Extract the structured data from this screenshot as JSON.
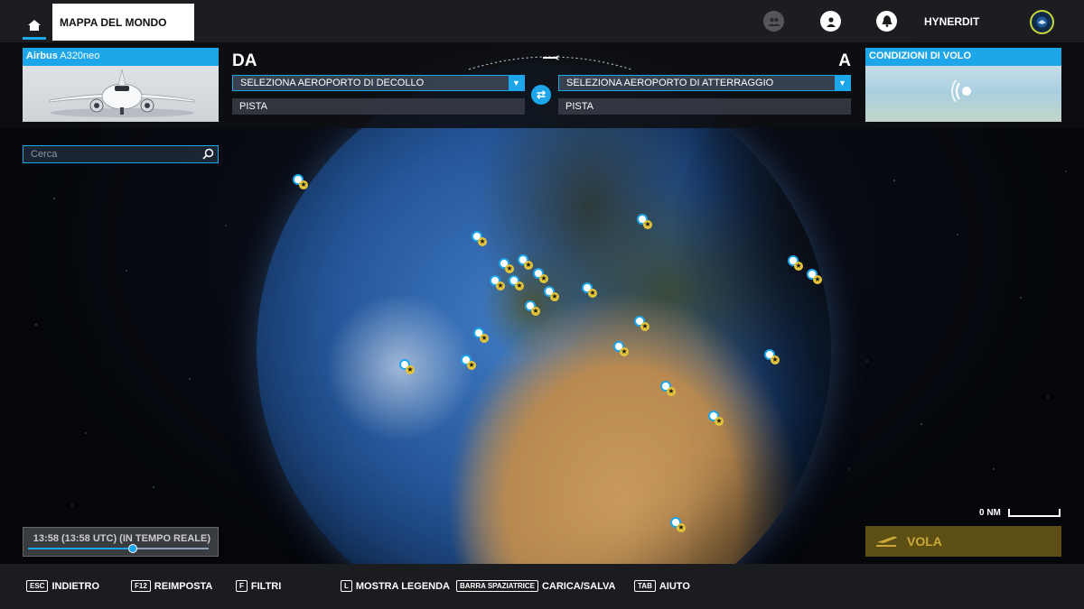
{
  "topbar": {
    "home_icon": "home-icon",
    "map_tab_label": "MAPPA DEL MONDO",
    "username": "HYNERDIT"
  },
  "aircraft": {
    "brand": "Airbus",
    "model": "A320neo"
  },
  "departure": {
    "label": "DA",
    "airport_placeholder": "SELEZIONA AEROPORTO DI DECOLLO",
    "runway_label": "PISTA"
  },
  "arrival": {
    "label": "A",
    "airport_placeholder": "SELEZIONA AEROPORTO DI ATTERRAGGIO",
    "runway_label": "PISTA"
  },
  "conditions": {
    "title": "CONDIZIONI DI VOLO"
  },
  "search": {
    "placeholder": "Cerca"
  },
  "time": {
    "label": "13:58 (13:58 UTC) (IN TEMPO REALE)",
    "progress": 0.58
  },
  "scale": {
    "label": "0 NM"
  },
  "fly_button": {
    "label": "VOLA"
  },
  "bottom_hints": [
    {
      "key": "ESC",
      "label": "INDIETRO"
    },
    {
      "key": "F12",
      "label": "REIMPOSTA"
    },
    {
      "key": "F",
      "label": "FILTRI"
    },
    {
      "key": "L",
      "label": "MOSTRA LEGENDA"
    },
    {
      "key": "BARRA SPAZIATRICE",
      "label": "CARICA/SALVA"
    },
    {
      "key": "TAB",
      "label": "AIUTO"
    }
  ],
  "colors": {
    "accent": "#1da6ea",
    "fly_gold": "#c9a93a",
    "badge_ring": "#c8d63a"
  }
}
